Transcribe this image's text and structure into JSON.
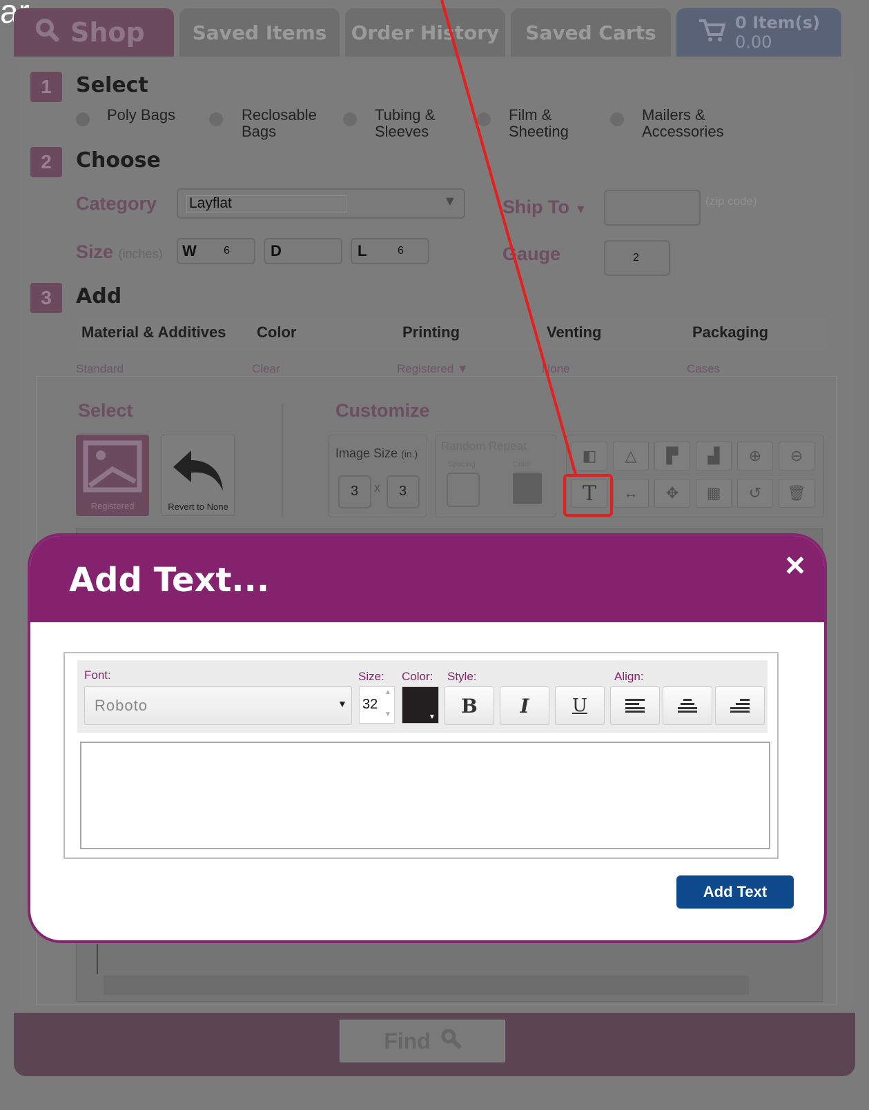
{
  "caption_fragment": "ar.",
  "tabs": {
    "shop": "Shop",
    "saved_items": "Saved Items",
    "order_history": "Order History",
    "saved_carts": "Saved Carts",
    "cart_count": "0 Item(s)",
    "cart_total": "0.00"
  },
  "step1": {
    "num": "1",
    "label": "Select",
    "options": [
      "Poly Bags",
      "Reclosable Bags",
      "Tubing & Sleeves",
      "Film & Sheeting",
      "Mailers & Accessories"
    ]
  },
  "step2": {
    "num": "2",
    "label": "Choose",
    "category_label": "Category",
    "category_value": "Layflat",
    "ship_to_label": "Ship To",
    "zip_hint": "(zip code)",
    "size_label": "Size",
    "size_unit": "(inches)",
    "w_label": "W",
    "w_value": "6",
    "d_label": "D",
    "l_label": "L",
    "l_value": "6",
    "gauge_label": "Gauge",
    "gauge_value": "2"
  },
  "step3": {
    "num": "3",
    "label": "Add",
    "columns": [
      {
        "title": "Material & Additives",
        "value": "Standard"
      },
      {
        "title": "Color",
        "value": "Clear"
      },
      {
        "title": "Printing",
        "value": "Registered"
      },
      {
        "title": "Venting",
        "value": "None"
      },
      {
        "title": "Packaging",
        "value": "Cases"
      }
    ]
  },
  "editor": {
    "select_title": "Select",
    "customize_title": "Customize",
    "registered_label": "Registered",
    "revert_label": "Revert to None",
    "image_size_label": "Image Size",
    "image_size_unit": "(in.)",
    "img_w": "3",
    "img_x": "x",
    "img_h": "3",
    "random_repeat": "Random Repeat",
    "spacing": "Spacing",
    "color": "Color"
  },
  "find_label": "Find",
  "modal": {
    "title": "Add Text...",
    "close": "×",
    "font_label": "Font:",
    "font_value": "Roboto",
    "size_label": "Size:",
    "size_value": "32",
    "color_label": "Color:",
    "color_value": "#231f20",
    "style_label": "Style:",
    "align_label": "Align:",
    "bold": "B",
    "italic": "I",
    "underline": "U",
    "add_button": "Add Text"
  },
  "colors": {
    "modal_header": "#84226e",
    "add_button": "#0e4a8c",
    "annotation": "#e61e1e"
  }
}
